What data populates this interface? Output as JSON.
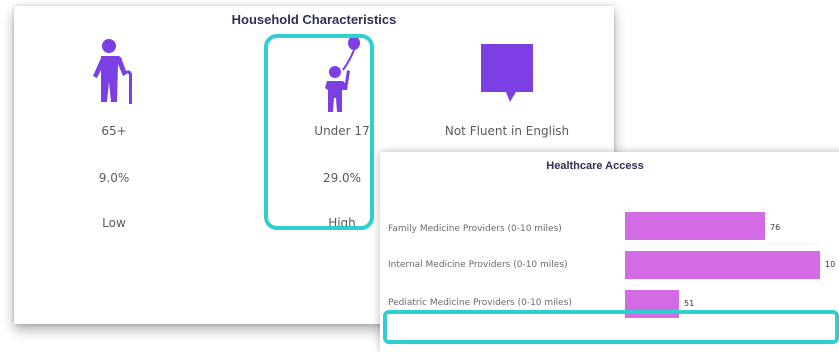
{
  "household": {
    "title": "Household Characteristics",
    "columns": [
      {
        "icon": "elderly-person-icon",
        "label": "65+",
        "value": "9.0%",
        "level": "Low"
      },
      {
        "icon": "child-balloon-icon",
        "label": "Under 17",
        "value": "29.0%",
        "level": "High"
      },
      {
        "icon": "speech-bubble-icon",
        "label": "Not Fluent in English"
      }
    ]
  },
  "healthcare": {
    "title": "Healthcare Access",
    "rows": [
      {
        "label": "Family Medicine Providers (0-10 miles)",
        "value": 76
      },
      {
        "label": "Internal Medicine Providers (0-10 miles)",
        "value": 10
      },
      {
        "label": "Pediatric Medicine Providers (0-10 miles)",
        "value": 51
      }
    ]
  },
  "colors": {
    "icon_purple": "#7b3fe4",
    "bar_pink": "#d26be4",
    "highlight_teal": "#2fcfcf",
    "title_navy": "#2f2f58"
  }
}
